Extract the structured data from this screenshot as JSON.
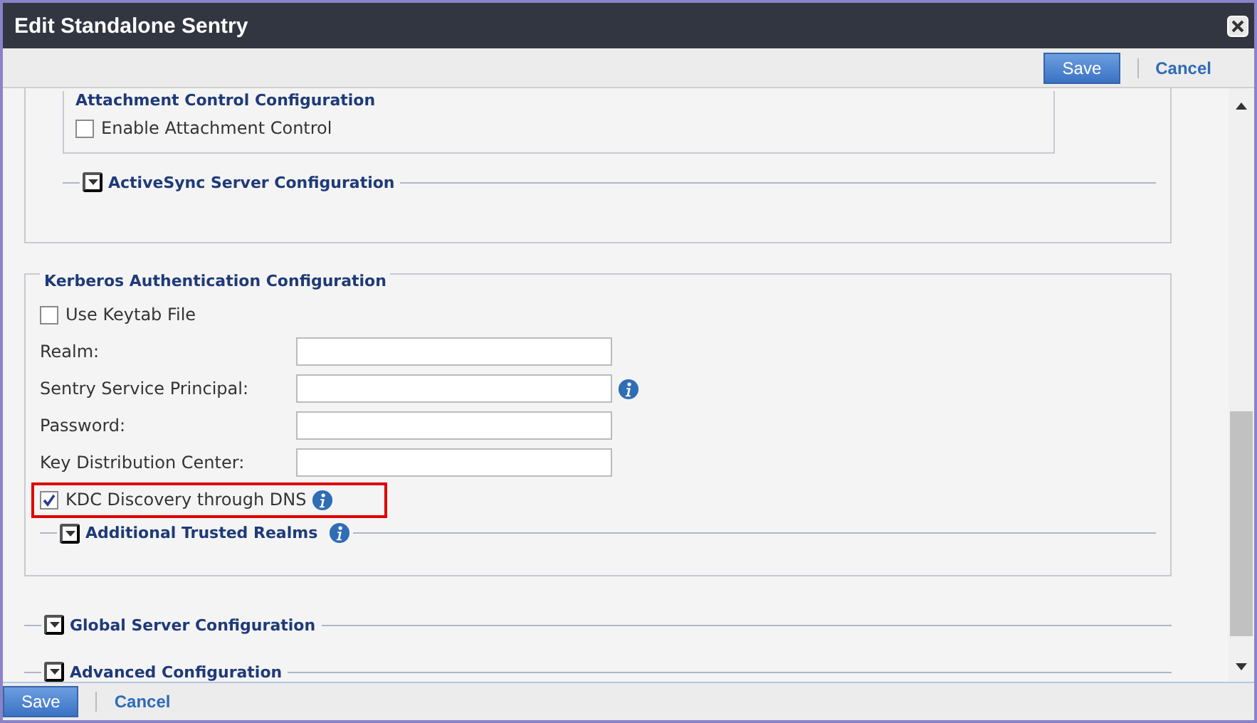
{
  "window": {
    "title": "Edit Standalone Sentry"
  },
  "top_actions": {
    "save": "Save",
    "cancel": "Cancel"
  },
  "server_section": {
    "attachment": {
      "title": "Attachment Control Configuration",
      "checkbox": {
        "label": "Enable Attachment Control",
        "checked": false
      }
    },
    "activesync": {
      "title": "ActiveSync Server Configuration",
      "expanded": false
    }
  },
  "kerberos": {
    "title": "Kerberos Authentication Configuration",
    "use_keytab": {
      "label": "Use Keytab File",
      "checked": false
    },
    "fields": [
      {
        "label": "Realm:",
        "info": false
      },
      {
        "label": "Sentry Service Principal:",
        "info": true
      },
      {
        "label": "Password:",
        "info": false
      },
      {
        "label": "Key Distribution Center:",
        "info": false
      }
    ],
    "kdc": {
      "label": "KDC Discovery through DNS",
      "checked": true,
      "info": true,
      "highlighted": true
    },
    "additional": {
      "title": "Additional Trusted Realms",
      "expanded": false,
      "info": true
    }
  },
  "sections": [
    {
      "title": "Global Server Configuration",
      "expanded": false
    },
    {
      "title": "Advanced Configuration",
      "expanded": false
    }
  ],
  "footer_actions": {
    "save": "Save",
    "cancel": "Cancel"
  }
}
